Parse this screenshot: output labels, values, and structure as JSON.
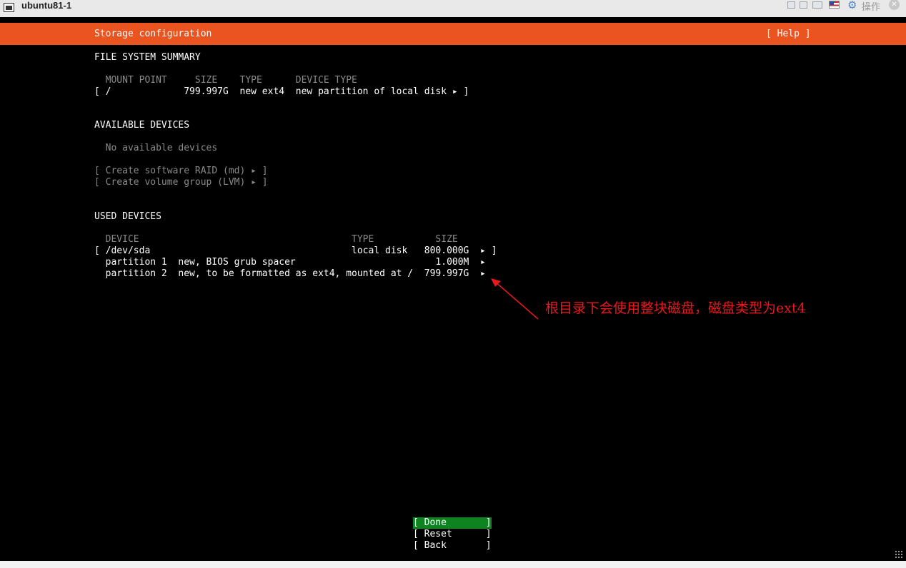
{
  "window": {
    "title": "ubuntu81-1",
    "action_label": "操作",
    "icons": [
      "terminal-icon",
      "minimize-icon",
      "restore-icon",
      "maximize-icon",
      "flag-icon",
      "gear-icon",
      "close-icon"
    ]
  },
  "header": {
    "title": "Storage configuration",
    "help": "[ Help ]",
    "accent": "#e95420"
  },
  "fs_summary": {
    "heading": "FILE SYSTEM SUMMARY",
    "columns": "  MOUNT POINT     SIZE    TYPE      DEVICE TYPE",
    "row": "[ /             799.997G  new ext4  new partition of local disk ▸ ]"
  },
  "available": {
    "heading": "AVAILABLE DEVICES",
    "empty": "  No available devices",
    "raid": "[ Create software RAID (md) ▸ ]",
    "lvm": "[ Create volume group (LVM) ▸ ]"
  },
  "used": {
    "heading": "USED DEVICES",
    "columns": "  DEVICE                                      TYPE           SIZE",
    "rows": [
      "[ /dev/sda                                    local disk   800.000G  ▸ ]",
      "  partition 1  new, BIOS grub spacer                         1.000M  ▸",
      "  partition 2  new, to be formatted as ext4, mounted at /  799.997G  ▸"
    ]
  },
  "buttons": {
    "done": "[ Done       ]",
    "reset": "[ Reset      ]",
    "back": "[ Back       ]",
    "done_color": "#0e8420"
  },
  "annotation": {
    "text": "根目录下会使用整块磁盘，磁盘类型为ext4",
    "color": "#e8181d"
  }
}
